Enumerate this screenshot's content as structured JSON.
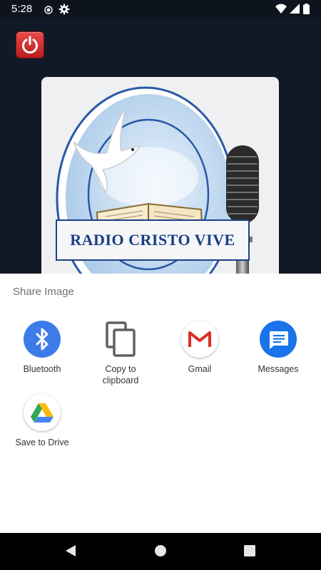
{
  "status_bar": {
    "time": "5:28",
    "icons": [
      "record-icon",
      "gear-icon",
      "wifi-icon",
      "signal-icon",
      "battery-icon"
    ]
  },
  "app": {
    "power_button_icon": "power-icon",
    "logo_text": "RADIO CRISTO VIVE"
  },
  "share_sheet": {
    "title": "Share Image",
    "targets": [
      {
        "label": "Bluetooth",
        "icon": "bluetooth-icon",
        "color": "#3d7be8"
      },
      {
        "label": "Copy to clipboard",
        "icon": "copy-icon",
        "color": "#616161"
      },
      {
        "label": "Gmail",
        "icon": "gmail-icon",
        "color": "#d93025"
      },
      {
        "label": "Messages",
        "icon": "messages-icon",
        "color": "#1a73e8"
      },
      {
        "label": "Save to Drive",
        "icon": "drive-icon",
        "color": "#34a853"
      }
    ]
  },
  "nav_bar": {
    "buttons": [
      "back-icon",
      "home-icon",
      "recents-icon"
    ]
  },
  "colors": {
    "background": "#111926",
    "sheet": "#ffffff",
    "accent_blue": "#3d7be8",
    "logo_blue": "#1b3d84"
  }
}
